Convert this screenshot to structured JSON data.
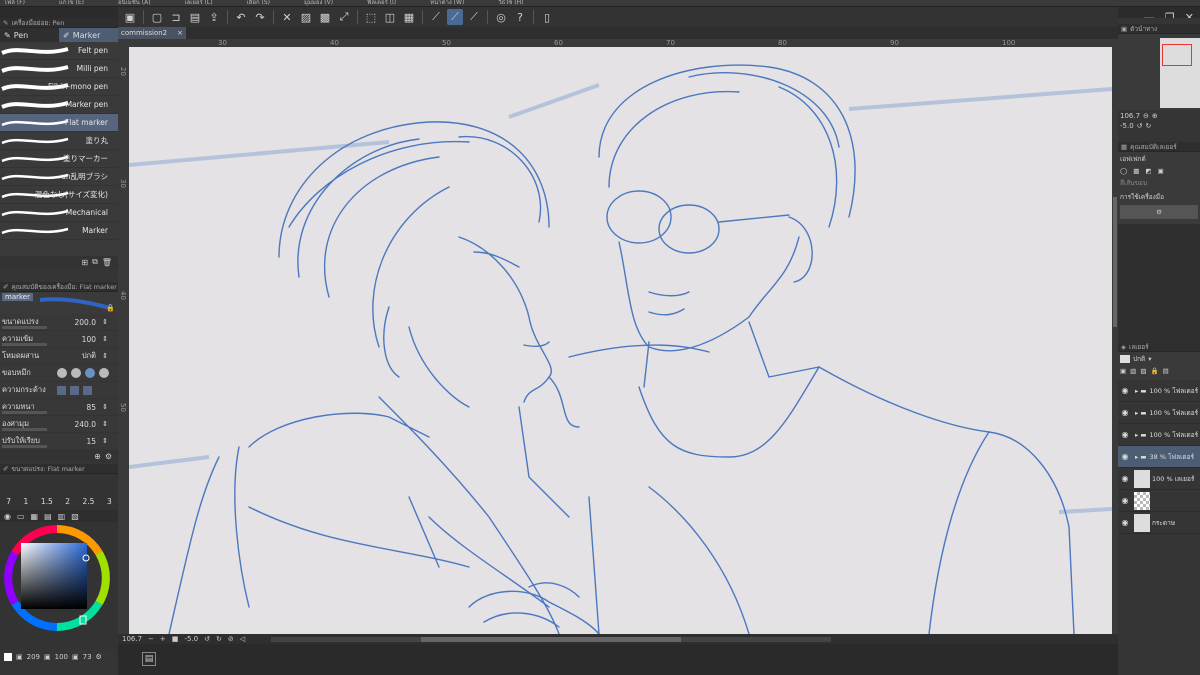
{
  "menu": [
    "ไฟล์ (F)",
    "แก้ไข (E)",
    "อนิเมชัน (A)",
    "เลเยอร์ (L)",
    "เลือก (S)",
    "มุมมอง (V)",
    "ฟิลเตอร์ (I)",
    "หน้าต่าง (W)",
    "วิธีใช้ (H)"
  ],
  "document": {
    "tab_label": "commission2",
    "close": "×"
  },
  "ruler_ticks": [
    "30",
    "40",
    "50",
    "60",
    "70",
    "80",
    "90",
    "100"
  ],
  "vruler_ticks": [
    "20",
    "30",
    "40",
    "50"
  ],
  "subtool": {
    "panel_title": "เครื่องมือย่อย: Pen",
    "tab_pen": "Pen",
    "tab_marker": "Marker",
    "brushes": [
      "Felt pen",
      "Milli pen",
      "Fill-in-mono pen",
      "Marker pen",
      "Flat marker",
      "塗り丸",
      "塗りマーカー",
      "un乱明ブラシ",
      "混色なし(サイズ変化)",
      "Mechanical",
      "Marker"
    ],
    "selected_brush": "Flat marker"
  },
  "tool_property": {
    "panel_title": "คุณสมบัติของเครื่องมือ: Flat marker",
    "preview_label": "marker",
    "rows": [
      {
        "label": "ขนาดแปรง",
        "value": "200.0"
      },
      {
        "label": "ความเข้ม",
        "value": "100"
      },
      {
        "label": "โหมดผสาน",
        "value": "ปกติ"
      },
      {
        "label": "ขอบหมึก",
        "value": ""
      },
      {
        "label": "ความกระด้าง",
        "value": ""
      },
      {
        "label": "ความหนา",
        "value": "85"
      },
      {
        "label": "องศามุม",
        "value": "240.0"
      },
      {
        "label": "ปรับให้เรียบ",
        "value": "15"
      }
    ]
  },
  "brush_size": {
    "panel_title": "ขนาดแปรง: Flat marker",
    "sizes": [
      "7",
      "1",
      "1.5",
      "2",
      "2.5",
      "3"
    ]
  },
  "color": {
    "r": "209",
    "g": "100",
    "b": "73",
    "accent": "#2b4a78"
  },
  "status": {
    "zoom": "106.7",
    "angle": "-5.0"
  },
  "navigator": {
    "zoom": "106.7",
    "angle": "-5.0",
    "tab": "ตัวนำทาง"
  },
  "effect_panel": {
    "tab": "คุณสมบัติเลเยอร์",
    "effect_label": "เอฟเฟกต์",
    "color_label": "สีเส้นขอบ",
    "tool_label": "การใช้เครื่องมือ"
  },
  "layers": {
    "tab": "เลเยอร์",
    "blend": "ปกติ",
    "rows": [
      {
        "label": "100 % โฟลเดอร์",
        "type": "folder"
      },
      {
        "label": "100 % โฟลเดอร์",
        "type": "folder"
      },
      {
        "label": "100 % โฟลเดอร์",
        "type": "folder"
      },
      {
        "label": "38 % โฟลเดอร์",
        "type": "folder",
        "selected": true
      },
      {
        "label": "100 % เลเยอร์",
        "type": "raster"
      },
      {
        "label": "",
        "type": "mask"
      },
      {
        "label": "กระดาษ",
        "type": "paper"
      }
    ]
  }
}
